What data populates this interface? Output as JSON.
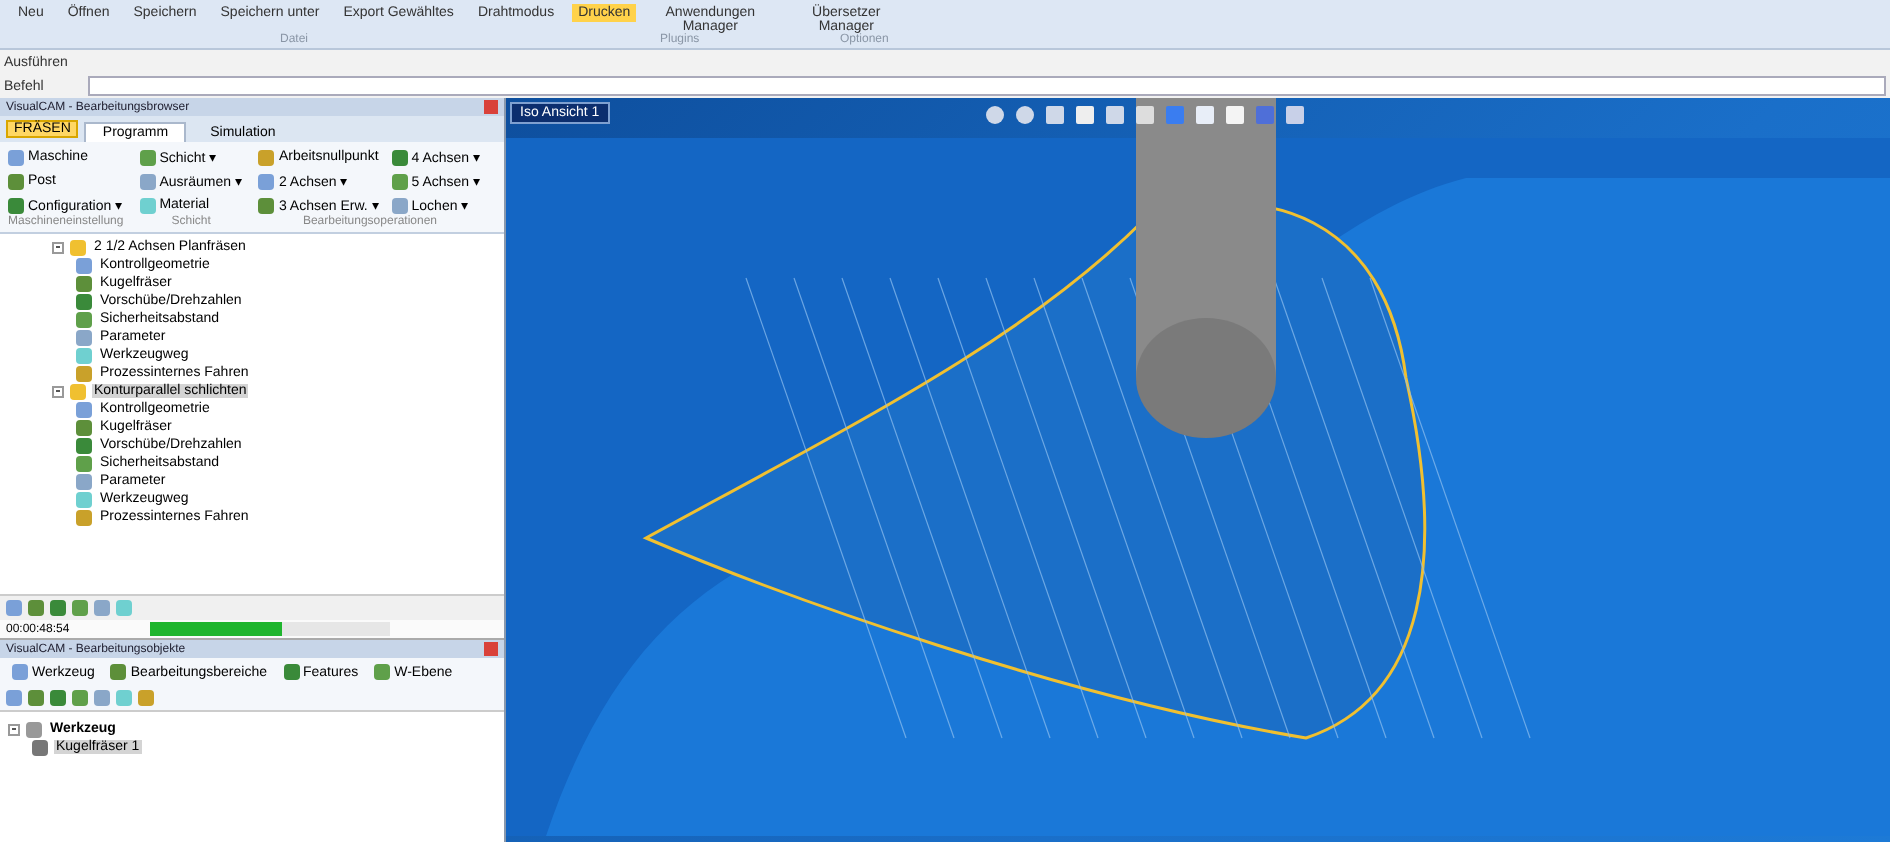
{
  "ribbon": {
    "buttons": [
      {
        "label": "Neu",
        "selected": false
      },
      {
        "label": "Öffnen",
        "selected": false
      },
      {
        "label": "Speichern",
        "selected": false
      },
      {
        "label": "Speichern unter",
        "selected": false
      },
      {
        "label": "Export Gewähltes",
        "selected": false
      },
      {
        "label": "Drahtmodus",
        "selected": false
      },
      {
        "label": "Drucken",
        "selected": true
      },
      {
        "label": "Anwendungen Manager",
        "selected": false
      },
      {
        "label": "Übersetzer Manager",
        "selected": false
      }
    ],
    "groups": [
      "Datei",
      "Plugins",
      "Optionen"
    ]
  },
  "command": {
    "output_label": "Ausführen",
    "input_label": "Befehl"
  },
  "browser": {
    "title": "VisualCAM - Bearbeitungsbrowser",
    "mode": "FRÄSEN",
    "tabs": [
      {
        "label": "Programm",
        "selected": true
      },
      {
        "label": "Simulation",
        "selected": false
      }
    ],
    "groups": [
      {
        "label": "Maschineneinstellung",
        "items": [
          "Maschine",
          "Post",
          "Configuration ▾"
        ]
      },
      {
        "label": "Schicht",
        "items": [
          "Schicht ▾",
          "Ausräumen ▾",
          "Material"
        ]
      },
      {
        "label": "Bearbeitungsoperationen",
        "items": [
          "Arbeitsnullpunkt",
          "2 Achsen ▾",
          "3 Achsen Erw. ▾",
          "4 Achsen ▾",
          "5 Achsen ▾",
          "Lochen ▾"
        ]
      }
    ],
    "tree": [
      {
        "label": "2 1/2 Achsen Planfräsen",
        "expanded": true,
        "selected": false,
        "children": [
          "Kontrollgeometrie",
          "Kugelfräser",
          "Vorschübe/Drehzahlen",
          "Sicherheitsabstand",
          "Parameter",
          "Werkzeugweg",
          "Prozessinternes Fahren"
        ]
      },
      {
        "label": "Konturparallel schlichten",
        "expanded": true,
        "selected": true,
        "children": [
          "Kontrollgeometrie",
          "Kugelfräser",
          "Vorschübe/Drehzahlen",
          "Sicherheitsabstand",
          "Parameter",
          "Werkzeugweg",
          "Prozessinternes Fahren"
        ]
      }
    ],
    "status": "00:00:48:54",
    "progress": {
      "level": 0.55
    }
  },
  "objects": {
    "title": "VisualCAM - Bearbeitungsobjekte",
    "tabs": [
      "Werkzeug",
      "Bearbeitungsbereiche",
      "Features",
      "W-Ebene"
    ],
    "tree": [
      {
        "label": "Werkzeug",
        "expanded": true,
        "children": [
          {
            "label": "Kugelfräser 1",
            "selected": true
          }
        ]
      }
    ]
  },
  "viewport": {
    "title": "Iso Ansicht 1"
  }
}
